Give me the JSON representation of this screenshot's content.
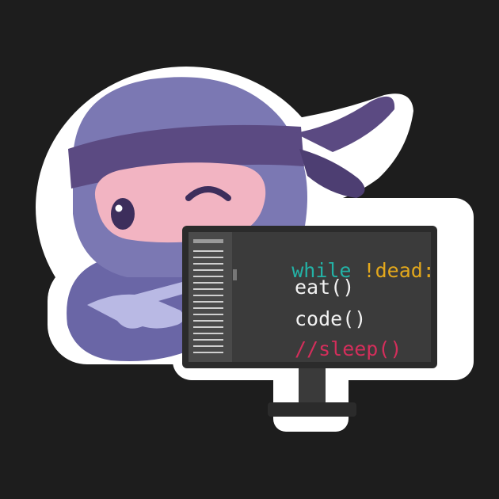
{
  "code": {
    "keyword": "while",
    "condition": "!dead:",
    "line_eat": "eat()",
    "line_code": "code()",
    "line_sleep": "//sleep()"
  },
  "colors": {
    "background": "#1d1d1d",
    "sticker_border": "#ffffff",
    "ninja_body": "#7b78b3",
    "ninja_shadow": "#625d9c",
    "headband": "#5b4a82",
    "face_skin": "#f2b4c2",
    "eye": "#3d2e5c",
    "hand": "#b9b9e4",
    "monitor_frame": "#2b2b2b",
    "screen_bg": "#3b3b3b",
    "keyword": "#23b2a6",
    "condition": "#e3a81c",
    "code_text": "#f2f2f2",
    "comment": "#d42e5b"
  }
}
